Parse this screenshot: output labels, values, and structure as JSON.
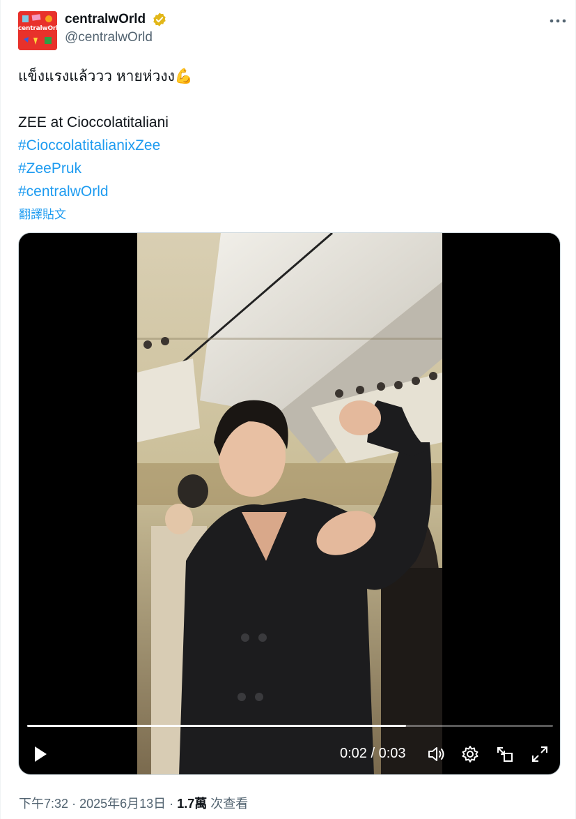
{
  "author": {
    "display_name": "centralwOrld",
    "handle": "@centralwOrld",
    "avatar_text": "centralwOrld",
    "verified": true,
    "verified_color": "#e2b719"
  },
  "tweet": {
    "lines": [
      "แข็งแรงแล้ววว หายห่วงง💪",
      "",
      "ZEE at Cioccolatitaliani"
    ],
    "hashtags": [
      "#CioccolatitalianixZee",
      "#ZeePruk",
      "#centralwOrld"
    ],
    "translate_label": "翻譯貼文",
    "link_color": "#1d9bf0"
  },
  "video": {
    "current_time": "0:02",
    "separator": "/",
    "duration": "0:03",
    "progress": 0.72
  },
  "meta": {
    "time": "下午7:32",
    "dot1": "·",
    "date": "2025年6月13日",
    "dot2": "·",
    "views": "1.7萬",
    "views_label": "次查看"
  },
  "icons": {
    "more": "more-horizontal-icon",
    "play": "play-icon",
    "volume": "volume-icon",
    "settings": "settings-gear-icon",
    "pip": "picture-in-picture-icon",
    "fullscreen": "fullscreen-icon"
  }
}
